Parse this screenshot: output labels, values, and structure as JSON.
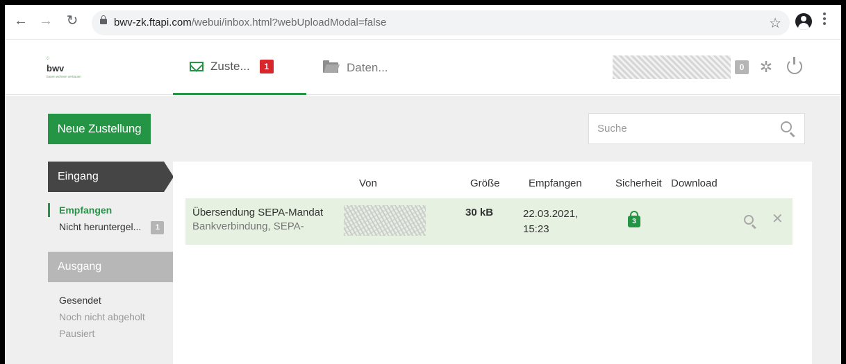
{
  "browser": {
    "url_host": "bwv-zk.ftapi.com",
    "url_path": "/webui/inbox.html?webUploadModal=false"
  },
  "header": {
    "logo_text": "bwv",
    "logo_sub": "bauen wohnen vertrauen",
    "tabs": [
      {
        "label": "Zuste...",
        "badge": "1"
      },
      {
        "label": "Daten..."
      }
    ],
    "notification_count": "0"
  },
  "toolbar": {
    "new_button": "Neue Zustellung",
    "search_placeholder": "Suche"
  },
  "sidebar": {
    "incoming_title": "Eingang",
    "incoming_items": [
      {
        "label": "Empfangen",
        "active": true
      },
      {
        "label": "Nicht heruntergel...",
        "count": "1"
      }
    ],
    "outgoing_title": "Ausgang",
    "outgoing_items": [
      {
        "label": "Gesendet"
      },
      {
        "label": "Noch nicht abgeholt"
      },
      {
        "label": "Pausiert"
      }
    ]
  },
  "table": {
    "columns": [
      "Von",
      "Größe",
      "Empfangen",
      "Sicherheit",
      "Download"
    ],
    "rows": [
      {
        "subject": "Übersendung SEPA-Mandat",
        "preview": "Bankverbindung, SEPA-",
        "size": "30 kB",
        "date": "22.03.2021,",
        "time": "15:23",
        "security_level": "3"
      }
    ]
  },
  "colors": {
    "brand_green": "#239544",
    "badge_red": "#d9262c",
    "row_highlight": "#e6f1e1"
  }
}
